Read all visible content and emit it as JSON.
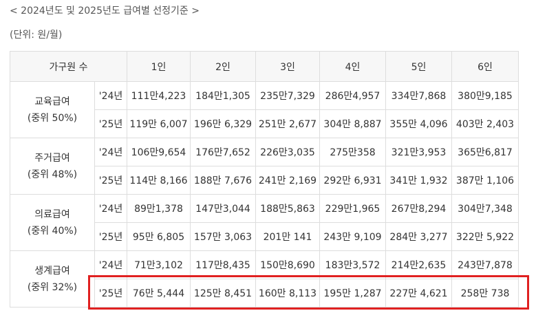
{
  "caption": "< 2024년도 및 2025년도 급여별 선정기준 >",
  "unit": "(단위: 원/월)",
  "table": {
    "header_first": "가구원 수",
    "columns": [
      "1인",
      "2인",
      "3인",
      "4인",
      "5인",
      "6인"
    ],
    "groups": [
      {
        "name": "교육급여",
        "sub": "(중위 50%)",
        "rows": [
          {
            "year": "'24년",
            "values": [
              "111만4,223",
              "184만1,305",
              "235만7,329",
              "286만4,957",
              "334만7,868",
              "380만9,185"
            ]
          },
          {
            "year": "'25년",
            "values": [
              "119만 6,007",
              "196만 6,329",
              "251만 2,677",
              "304만 8,887",
              "355만 4,096",
              "403만 2,403"
            ]
          }
        ]
      },
      {
        "name": "주거급여",
        "sub": "(중위 48%)",
        "rows": [
          {
            "year": "'24년",
            "values": [
              "106만9,654",
              "176만7,652",
              "226만3,035",
              "275만358",
              "321만3,953",
              "365만6,817"
            ]
          },
          {
            "year": "'25년",
            "values": [
              "114만 8,166",
              "188만 7,676",
              "241만 2,169",
              "292만 6,931",
              "341만 1,932",
              "387만 1,106"
            ]
          }
        ]
      },
      {
        "name": "의료급여",
        "sub": "(중위 40%)",
        "rows": [
          {
            "year": "'24년",
            "values": [
              "89만1,378",
              "147만3,044",
              "188만5,863",
              "229만1,965",
              "267만8,294",
              "304만7,348"
            ]
          },
          {
            "year": "'25년",
            "values": [
              "95만 6,805",
              "157만 3,063",
              "201만 141",
              "243만 9,109",
              "284만 3,277",
              "322만 5,922"
            ]
          }
        ]
      },
      {
        "name": "생계급여",
        "sub": "(중위 32%)",
        "rows": [
          {
            "year": "'24년",
            "values": [
              "71만3,102",
              "117만8,435",
              "150만8,690",
              "183만3,572",
              "214만2,635",
              "243만7,878"
            ]
          },
          {
            "year": "'25년",
            "values": [
              "76만 5,444",
              "125만 8,451",
              "160만 8,113",
              "195만 1,287",
              "227만 4,621",
              "258만 738"
            ]
          }
        ]
      }
    ]
  },
  "highlight_color": "#e02020"
}
